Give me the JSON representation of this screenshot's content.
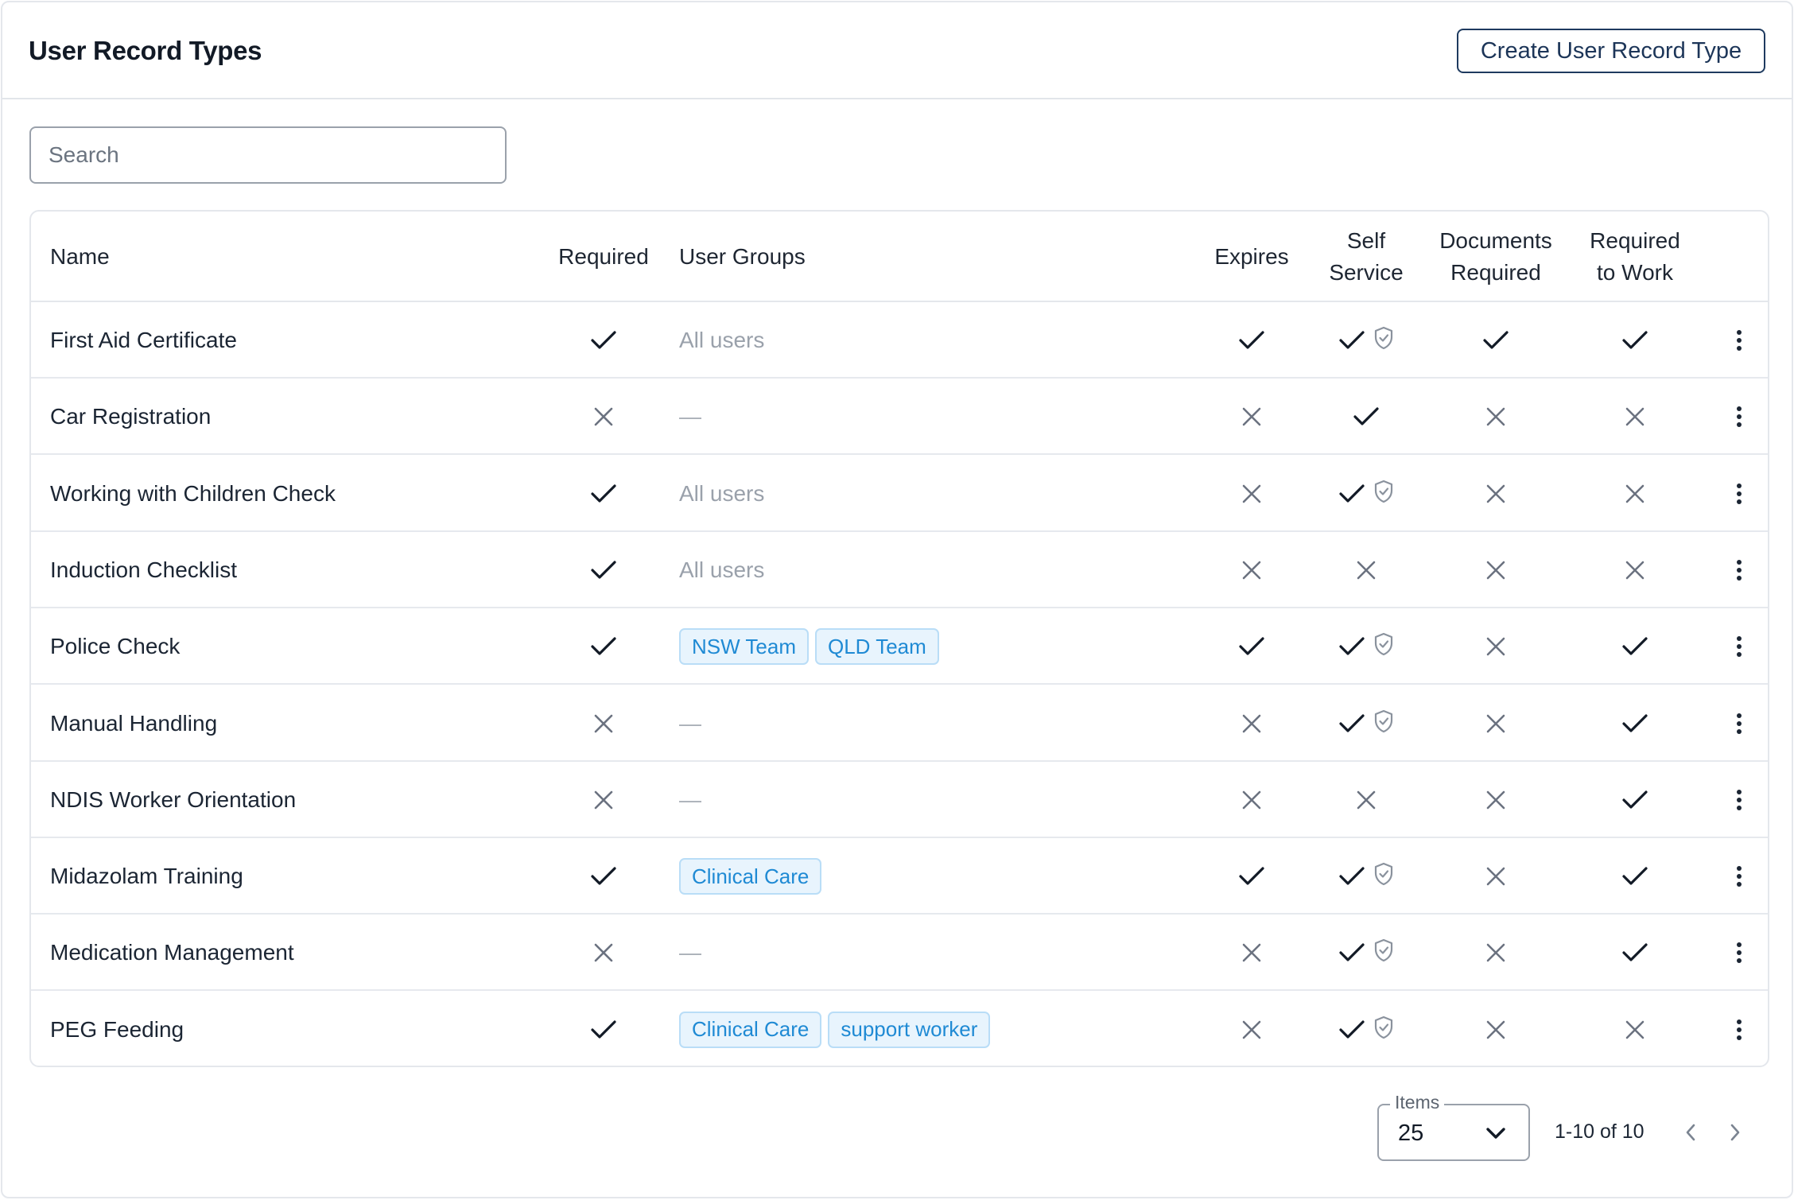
{
  "header": {
    "title": "User Record Types",
    "create_label": "Create User Record Type"
  },
  "search": {
    "placeholder": "Search",
    "value": ""
  },
  "table": {
    "columns": {
      "name": "Name",
      "required": "Required",
      "user_groups": "User Groups",
      "expires": "Expires",
      "self_service_1": "Self",
      "self_service_2": "Service",
      "documents_1": "Documents",
      "documents_2": "Required",
      "required_to_work_1": "Required",
      "required_to_work_2": "to Work"
    },
    "rows": [
      {
        "name": "First Aid Certificate",
        "required": true,
        "groups_text": "All users",
        "groups": [],
        "expires": true,
        "self_service": true,
        "self_service_shield": true,
        "documents_required": true,
        "required_to_work": true
      },
      {
        "name": "Car Registration",
        "required": false,
        "groups_text": "—",
        "groups": [],
        "expires": false,
        "self_service": true,
        "self_service_shield": false,
        "documents_required": false,
        "required_to_work": false
      },
      {
        "name": "Working with Children Check",
        "required": true,
        "groups_text": "All users",
        "groups": [],
        "expires": false,
        "self_service": true,
        "self_service_shield": true,
        "documents_required": false,
        "required_to_work": false
      },
      {
        "name": "Induction Checklist",
        "required": true,
        "groups_text": "All users",
        "groups": [],
        "expires": false,
        "self_service": false,
        "self_service_shield": false,
        "documents_required": false,
        "required_to_work": false
      },
      {
        "name": "Police Check",
        "required": true,
        "groups_text": "",
        "groups": [
          "NSW Team",
          "QLD Team"
        ],
        "expires": true,
        "self_service": true,
        "self_service_shield": true,
        "documents_required": false,
        "required_to_work": true
      },
      {
        "name": "Manual Handling",
        "required": false,
        "groups_text": "—",
        "groups": [],
        "expires": false,
        "self_service": true,
        "self_service_shield": true,
        "documents_required": false,
        "required_to_work": true
      },
      {
        "name": "NDIS Worker Orientation",
        "required": false,
        "groups_text": "—",
        "groups": [],
        "expires": false,
        "self_service": false,
        "self_service_shield": false,
        "documents_required": false,
        "required_to_work": true
      },
      {
        "name": "Midazolam Training",
        "required": true,
        "groups_text": "",
        "groups": [
          "Clinical Care"
        ],
        "expires": true,
        "self_service": true,
        "self_service_shield": true,
        "documents_required": false,
        "required_to_work": true
      },
      {
        "name": "Medication Management",
        "required": false,
        "groups_text": "—",
        "groups": [],
        "expires": false,
        "self_service": true,
        "self_service_shield": true,
        "documents_required": false,
        "required_to_work": true
      },
      {
        "name": "PEG Feeding",
        "required": true,
        "groups_text": "",
        "groups": [
          "Clinical Care",
          "support worker"
        ],
        "expires": false,
        "self_service": true,
        "self_service_shield": true,
        "documents_required": false,
        "required_to_work": false
      }
    ]
  },
  "pagination": {
    "items_label": "Items",
    "items_value": "25",
    "range": "1-10 of 10"
  },
  "icons": {
    "check": "check-icon",
    "cross": "cross-icon",
    "shield": "shield-check-icon",
    "menu": "vertical-dots-icon",
    "chevron_down": "chevron-down-icon",
    "prev": "chevron-left-icon",
    "next": "chevron-right-icon"
  },
  "colors": {
    "check": "#121a26",
    "cross": "#6b7280",
    "chip_bg": "#e8f4fd",
    "chip_text": "#1f8ad4",
    "primary_border": "#1e3a5f"
  }
}
